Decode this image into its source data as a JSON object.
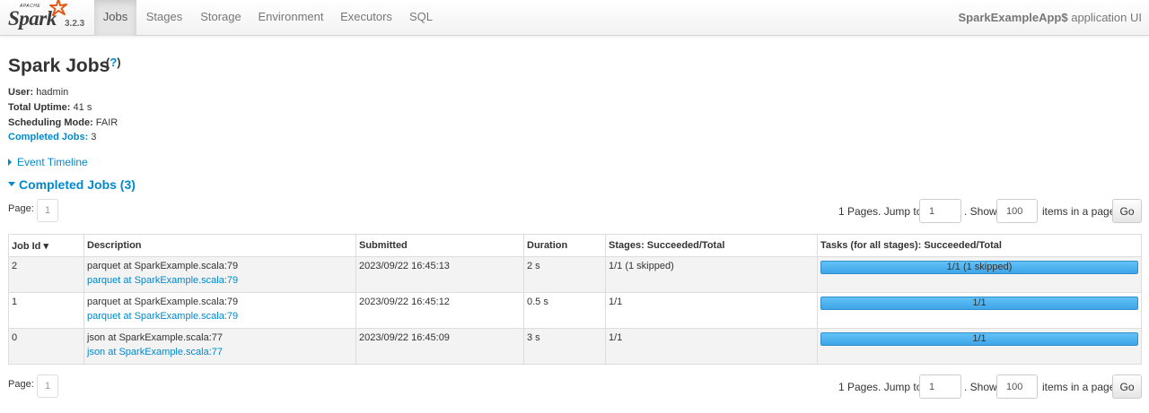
{
  "brand": {
    "apache": "APACHE",
    "name": "Spark",
    "version": "3.2.3"
  },
  "nav": {
    "tabs": [
      {
        "label": "Jobs",
        "active": true
      },
      {
        "label": "Stages",
        "active": false
      },
      {
        "label": "Storage",
        "active": false
      },
      {
        "label": "Environment",
        "active": false
      },
      {
        "label": "Executors",
        "active": false
      },
      {
        "label": "SQL",
        "active": false
      }
    ],
    "app_name": "SparkExampleApp$",
    "app_suffix": " application UI"
  },
  "page": {
    "title": "Spark Jobs",
    "help": "?"
  },
  "summary": {
    "user_label": "User:",
    "user": "hadmin",
    "uptime_label": "Total Uptime:",
    "uptime": "41 s",
    "mode_label": "Scheduling Mode:",
    "mode": "FAIR",
    "completed_label": "Completed Jobs:",
    "completed": "3"
  },
  "event_timeline": "Event Timeline",
  "completed_section": "Completed Jobs (3)",
  "pagination": {
    "page_label": "Page:",
    "current_page": "1",
    "pages_text": "1 Pages. Jump to",
    "jump_value": "1",
    "show_text": ". Show",
    "show_value": "100",
    "items_text": "items in a page.",
    "go_label": "Go"
  },
  "table": {
    "headers": [
      "Job Id ▾",
      "Description",
      "Submitted",
      "Duration",
      "Stages: Succeeded/Total",
      "Tasks (for all stages): Succeeded/Total"
    ],
    "rows": [
      {
        "id": "2",
        "desc": "parquet at SparkExample.scala:79",
        "desc_link": "parquet at SparkExample.scala:79",
        "submitted": "2023/09/22 16:45:13",
        "duration": "2 s",
        "stages": "1/1 (1 skipped)",
        "tasks": "1/1 (1 skipped)",
        "progress": 1.0
      },
      {
        "id": "1",
        "desc": "parquet at SparkExample.scala:79",
        "desc_link": "parquet at SparkExample.scala:79",
        "submitted": "2023/09/22 16:45:12",
        "duration": "0.5 s",
        "stages": "1/1",
        "tasks": "1/1",
        "progress": 1.0
      },
      {
        "id": "0",
        "desc": "json at SparkExample.scala:77",
        "desc_link": "json at SparkExample.scala:77",
        "submitted": "2023/09/22 16:45:09",
        "duration": "3 s",
        "stages": "1/1",
        "tasks": "1/1",
        "progress": 1.0
      }
    ]
  },
  "colors": {
    "link": "#0088cc",
    "progress": "#3ea5e8"
  }
}
